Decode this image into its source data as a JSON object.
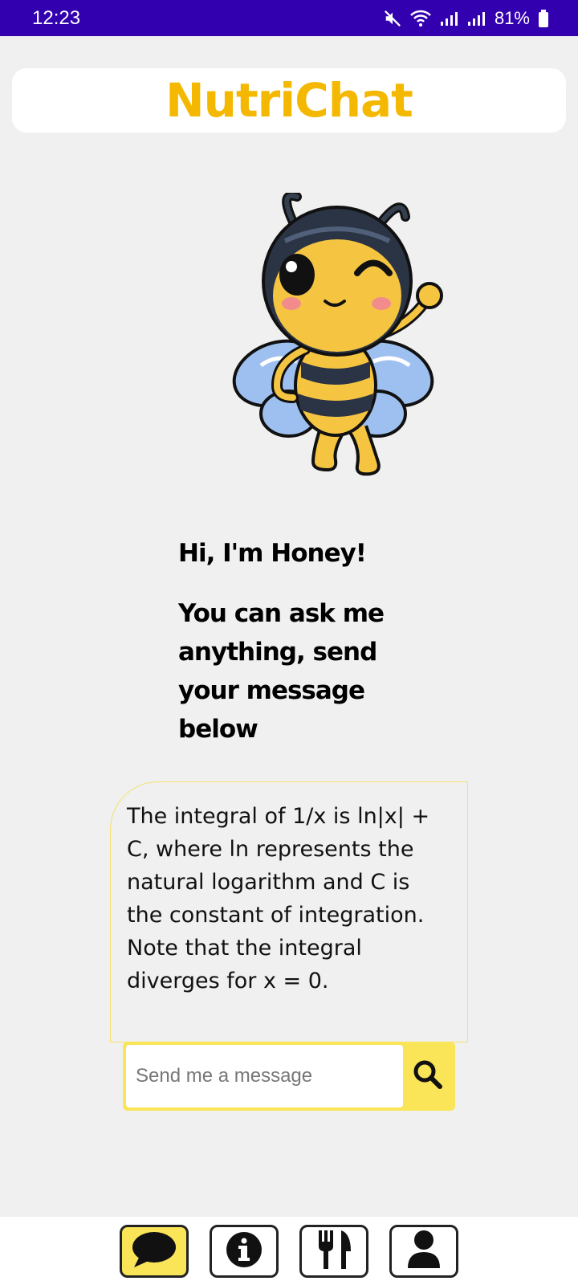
{
  "status_bar": {
    "time": "12:23",
    "battery": "81%",
    "icons": [
      "mute-icon",
      "wifi-icon",
      "signal-icon",
      "signal-icon",
      "battery-icon"
    ]
  },
  "header": {
    "title": "NutriChat"
  },
  "greeting": {
    "line1": "Hi, I'm Honey!",
    "line2": "You can ask me anything, send your message below"
  },
  "response": {
    "text": "The integral of 1/x is ln|x| + C, where ln represents the natural logarithm and C is the constant of integration. Note that the integral diverges for x = 0."
  },
  "input": {
    "placeholder": "Send me a message",
    "value": ""
  },
  "nav": {
    "items": [
      {
        "icon": "chat-icon",
        "active": true
      },
      {
        "icon": "info-icon",
        "active": false
      },
      {
        "icon": "fork-knife-icon",
        "active": false
      },
      {
        "icon": "user-icon",
        "active": false
      }
    ]
  },
  "colors": {
    "status_bar": "#3300b0",
    "title": "#f5b800",
    "accent": "#fae457",
    "background": "#f0f0f0"
  }
}
